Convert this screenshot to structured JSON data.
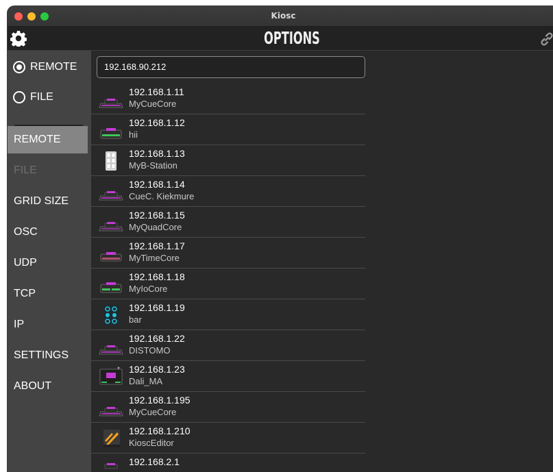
{
  "window": {
    "title": "Kiosc"
  },
  "header": {
    "title": "OPTIONS"
  },
  "sidebar": {
    "radios": [
      {
        "label": "REMOTE",
        "checked": true
      },
      {
        "label": "FILE",
        "checked": false
      }
    ],
    "items": [
      {
        "label": "REMOTE",
        "state": "active"
      },
      {
        "label": "FILE",
        "state": "disabled"
      },
      {
        "label": "GRID SIZE",
        "state": "normal"
      },
      {
        "label": "OSC",
        "state": "normal"
      },
      {
        "label": "UDP",
        "state": "normal"
      },
      {
        "label": "TCP",
        "state": "normal"
      },
      {
        "label": "IP",
        "state": "normal"
      },
      {
        "label": "SETTINGS",
        "state": "normal"
      },
      {
        "label": "ABOUT",
        "state": "normal"
      }
    ]
  },
  "main": {
    "ip_input": {
      "value": "192.168.90.212"
    },
    "devices": [
      {
        "ip": "192.168.1.11",
        "name": "MyCueCore",
        "icon": "cuecore-device-icon"
      },
      {
        "ip": "192.168.1.12",
        "name": "hii",
        "icon": "iocore-device-icon"
      },
      {
        "ip": "192.168.1.13",
        "name": "MyB-Station",
        "icon": "b-station-device-icon"
      },
      {
        "ip": "192.168.1.14",
        "name": "CueC. Kiekmure",
        "icon": "cuecore-device-icon"
      },
      {
        "ip": "192.168.1.15",
        "name": "MyQuadCore",
        "icon": "quadcore-device-icon"
      },
      {
        "ip": "192.168.1.17",
        "name": "MyTimeCore",
        "icon": "timecore-device-icon"
      },
      {
        "ip": "192.168.1.18",
        "name": "MyIoCore",
        "icon": "iocore-device-icon"
      },
      {
        "ip": "192.168.1.19",
        "name": "bar",
        "icon": "button-pad-device-icon"
      },
      {
        "ip": "192.168.1.22",
        "name": "DISTOMO",
        "icon": "cuecore-device-icon"
      },
      {
        "ip": "192.168.1.23",
        "name": "Dali_MA",
        "icon": "dali-device-icon"
      },
      {
        "ip": "192.168.1.195",
        "name": "MyCueCore",
        "icon": "cuecore-device-icon"
      },
      {
        "ip": "192.168.1.210",
        "name": "KioscEditor",
        "icon": "kiosc-editor-icon"
      },
      {
        "ip": "192.168.2.1",
        "name": "",
        "icon": "cuecore-device-icon"
      }
    ]
  },
  "colors": {
    "accent": "#c33ad6",
    "green": "#3ec45a",
    "cyan": "#25c3d9"
  }
}
